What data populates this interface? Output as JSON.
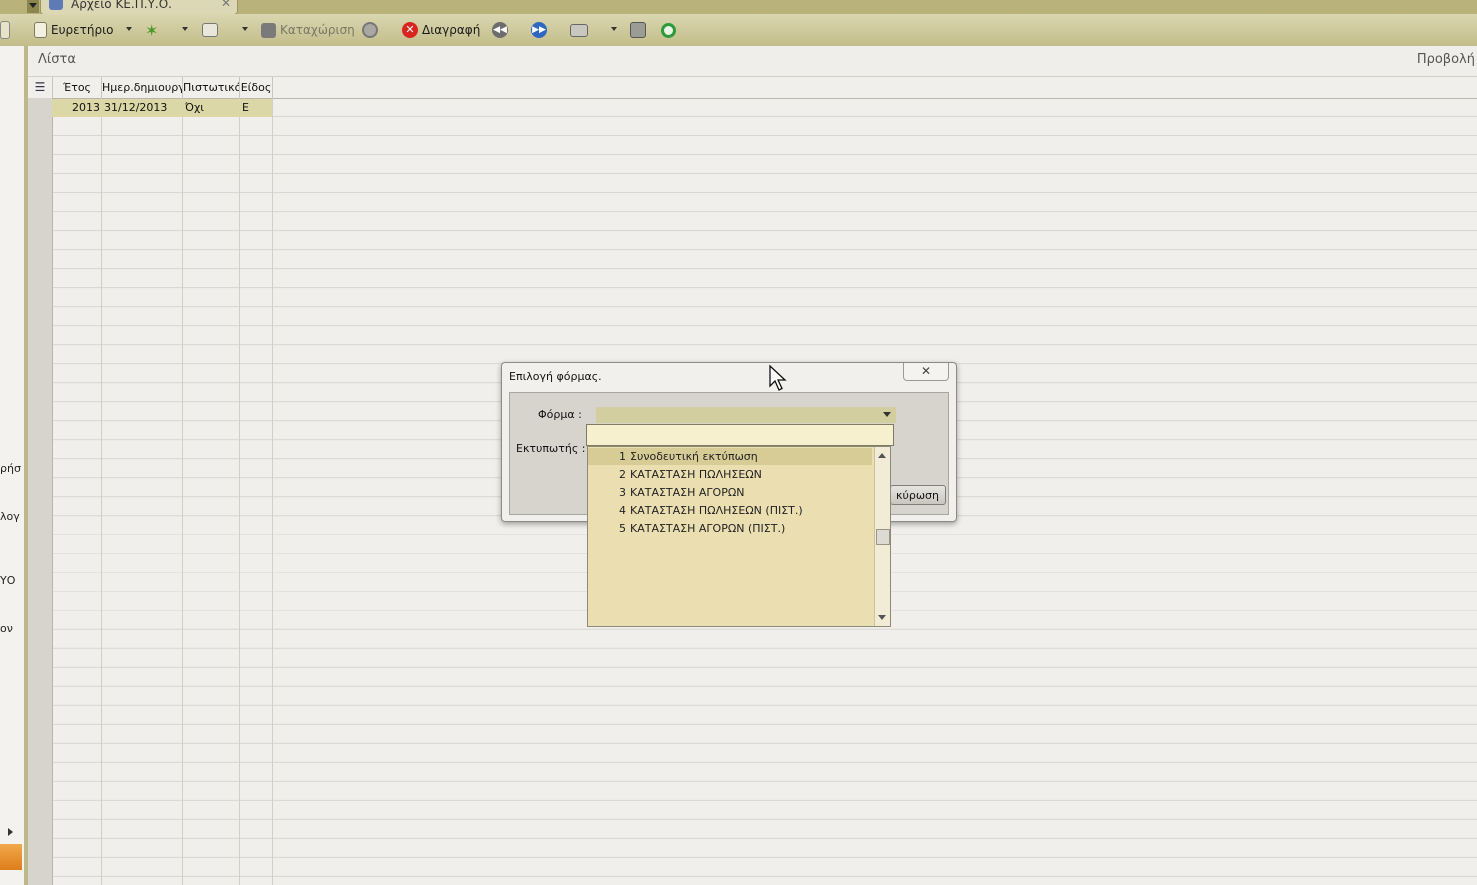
{
  "window": {
    "tab_title": "Αρχείο ΚΕ.Π.Υ.Ο.",
    "close_glyph": "✕"
  },
  "toolbar": {
    "index_label": "Ευρετήριο",
    "save_label": "Καταχώριση",
    "delete_label": "Διαγραφή"
  },
  "section": {
    "list_label": "Λίστα",
    "view_label": "Προβολή"
  },
  "left_panel": {
    "labels": [
      "ρήσ",
      "λογ",
      "ΥΟ",
      "ον"
    ]
  },
  "grid": {
    "columns": [
      "Έτος",
      "Ημερ.δημιουργ",
      "Πιστωτικό",
      "Είδος"
    ],
    "rows": [
      {
        "year": "2013",
        "date": "31/12/2013",
        "credit": "Όχι",
        "type": "Ε"
      }
    ]
  },
  "dialog": {
    "title": "Επιλογή φόρμας.",
    "close_glyph": "✕",
    "form_label": "Φόρμα :",
    "printer_label": "Εκτυπωτής :",
    "cancel_label": "κύρωση",
    "search_value": "",
    "options": [
      {
        "num": "1",
        "label": "Συνοδευτική εκτύπωση"
      },
      {
        "num": "2",
        "label": "ΚΑΤΑΣΤΑΣΗ ΠΩΛΗΣΕΩΝ"
      },
      {
        "num": "3",
        "label": "ΚΑΤΑΣΤΑΣΗ ΑΓΟΡΩΝ"
      },
      {
        "num": "4",
        "label": "ΚΑΤΑΣΤΑΣΗ ΠΩΛΗΣΕΩΝ (ΠΙΣΤ.)"
      },
      {
        "num": "5",
        "label": "ΚΑΤΑΣΤΑΣΗ ΑΓΟΡΩΝ (ΠΙΣΤ.)"
      }
    ],
    "selected_index": 0
  },
  "colors": {
    "accent": "#c3bd8a",
    "selection": "#dcd7a7",
    "list_bg": "#ebdfb2"
  }
}
